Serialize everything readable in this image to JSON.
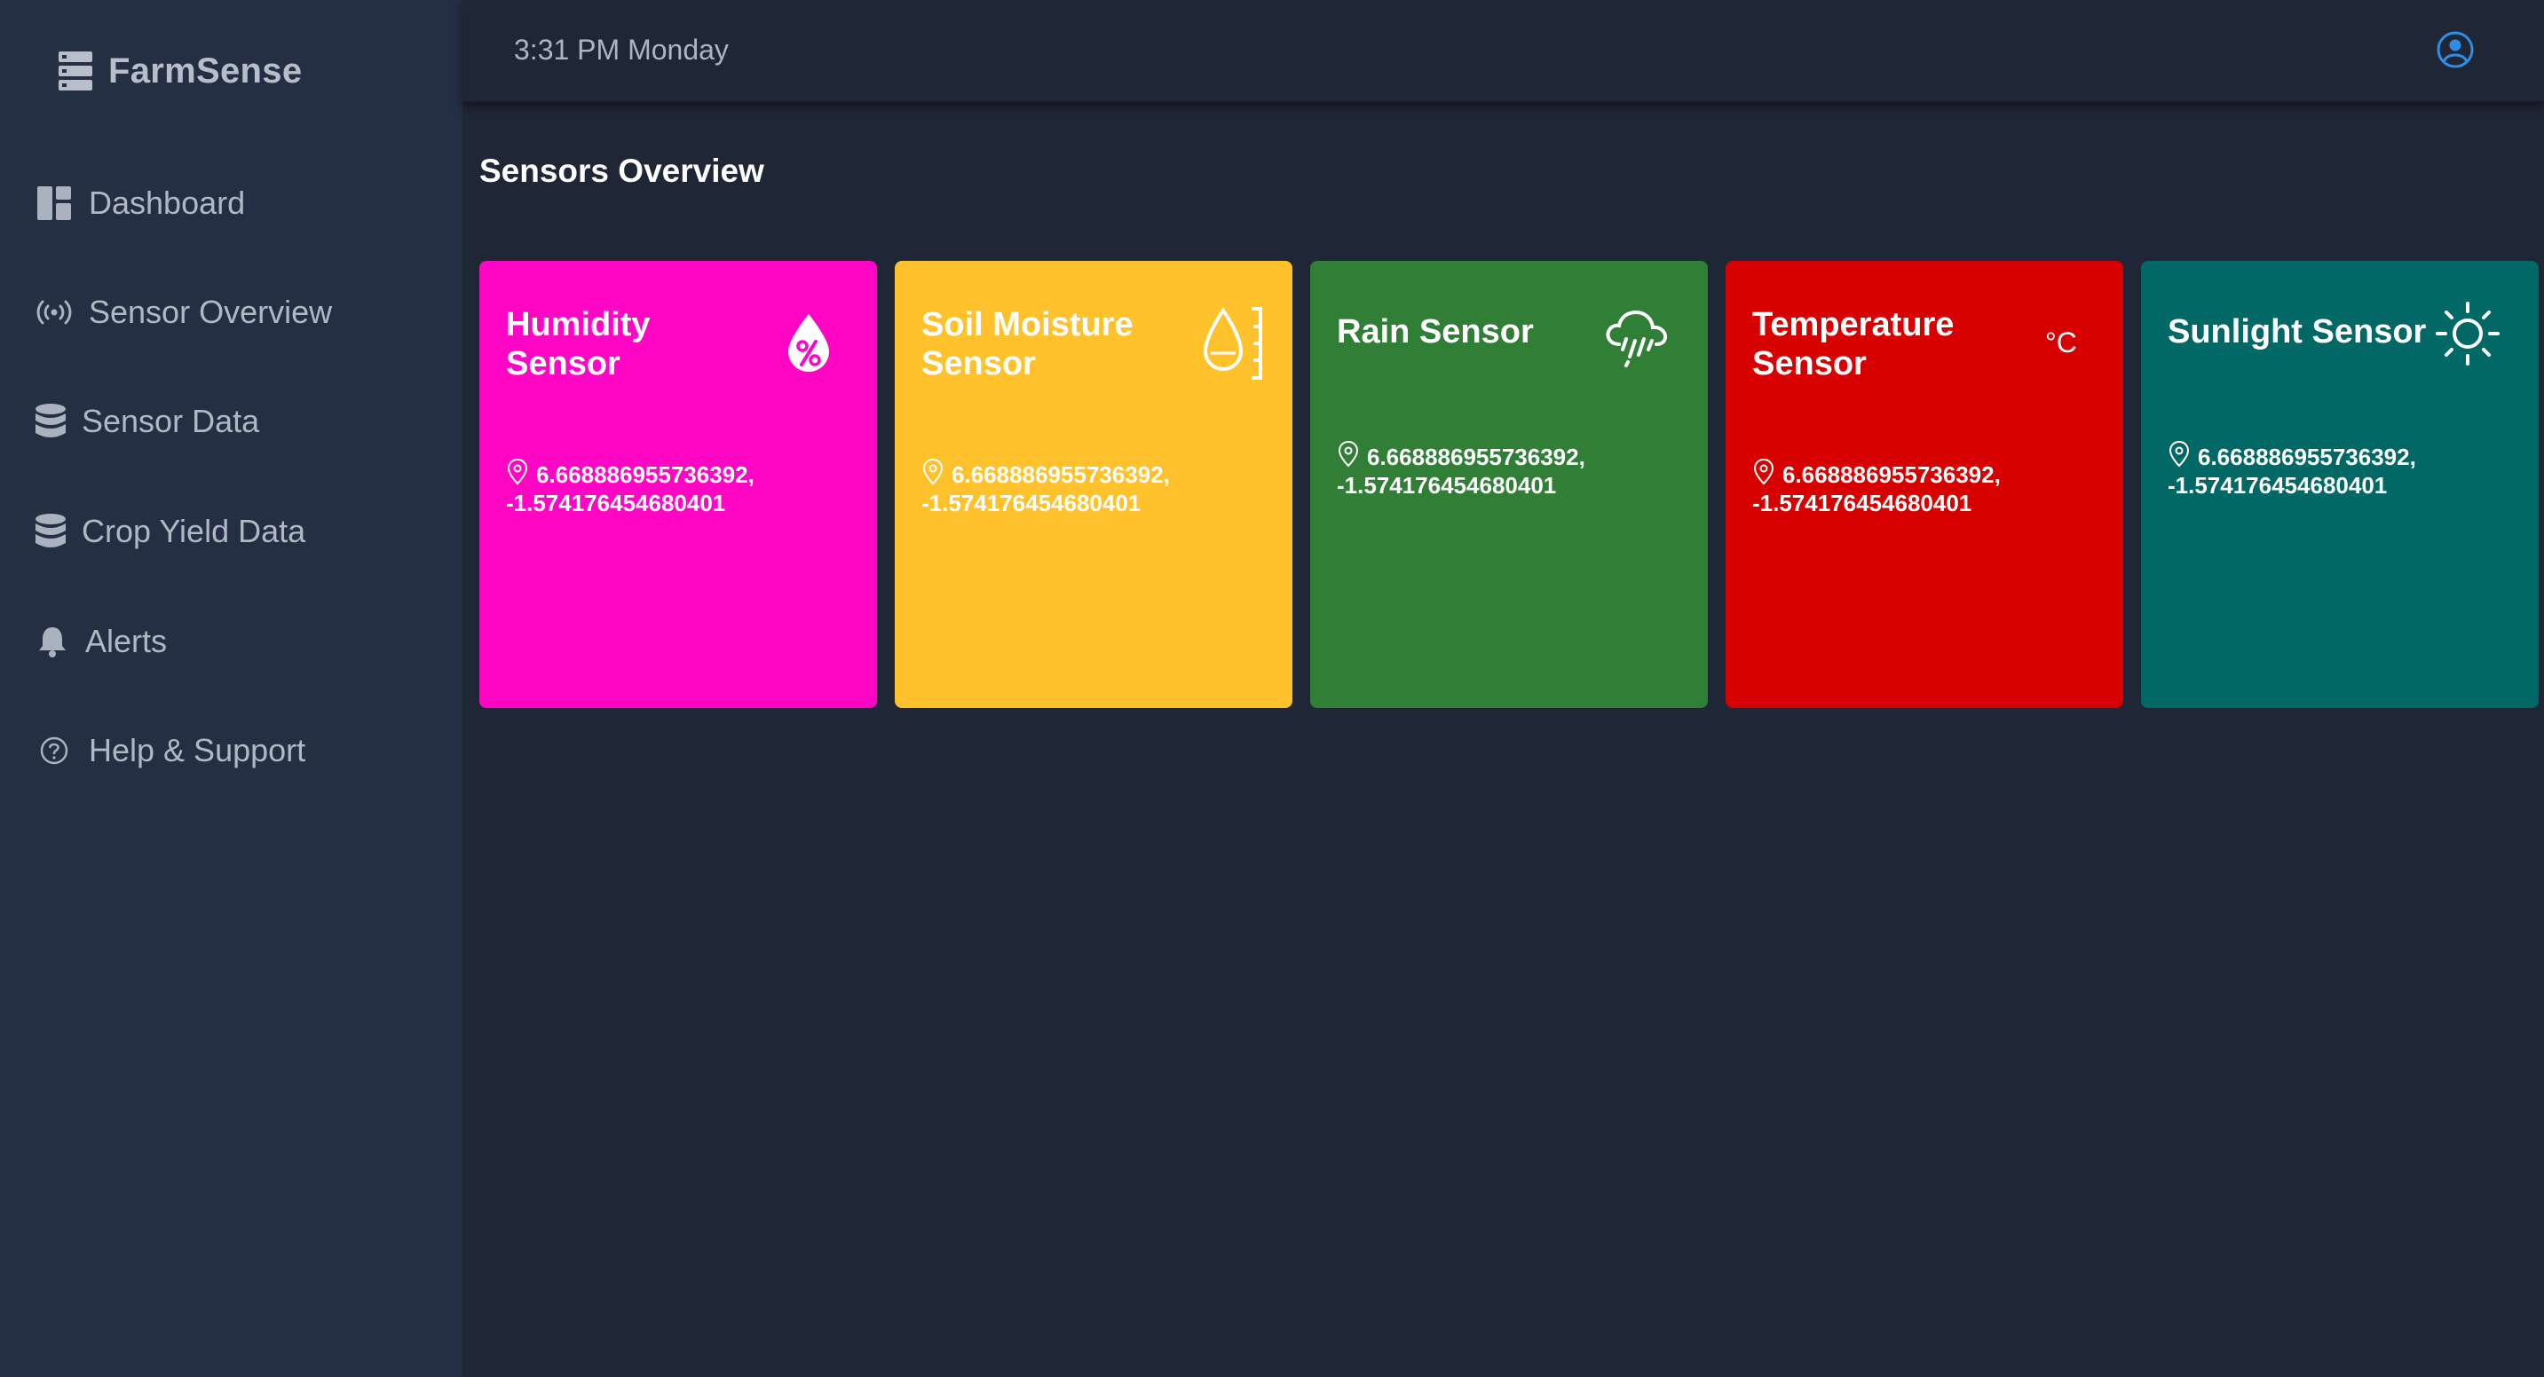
{
  "app": {
    "name": "FarmSense"
  },
  "sidebar": {
    "items": [
      {
        "label": "Dashboard",
        "icon": "dashboard-icon"
      },
      {
        "label": "Sensor Overview",
        "icon": "broadcast-icon"
      },
      {
        "label": "Sensor Data",
        "icon": "database-icon"
      },
      {
        "label": "Crop Yield Data",
        "icon": "database-icon"
      },
      {
        "label": "Alerts",
        "icon": "bell-icon"
      },
      {
        "label": "Help & Support",
        "icon": "help-icon"
      }
    ]
  },
  "header": {
    "time": "3:31 PM Monday",
    "user_icon": "user-circle-icon"
  },
  "main": {
    "title": "Sensors Overview",
    "cards": [
      {
        "title_line1": "Humidity",
        "title_line2": "Sensor",
        "icon": "humidity-drop-percent-icon",
        "coord_lat": "6.668886955736392,",
        "coord_lng": "-1.574176454680401",
        "color": "#ff06c5"
      },
      {
        "title_line1": "Soil Moisture",
        "title_line2": "Sensor",
        "icon": "soil-moisture-icon",
        "coord_lat": "6.668886955736392,",
        "coord_lng": "-1.574176454680401",
        "color": "#ffc22c"
      },
      {
        "title_line1": "Rain Sensor",
        "title_line2": "",
        "icon": "rain-cloud-icon",
        "coord_lat": "6.668886955736392,",
        "coord_lng": "-1.574176454680401",
        "color": "#317f37"
      },
      {
        "title_line1": "Temperature",
        "title_line2": "Sensor",
        "icon": "celsius-icon",
        "icon_text": "°C",
        "coord_lat": "6.668886955736392,",
        "coord_lng": "-1.574176454680401",
        "color": "#d60000"
      },
      {
        "title_line1": "Sunlight Sensor",
        "title_line2": "",
        "icon": "sun-icon",
        "coord_lat": "6.668886955736392,",
        "coord_lng": "-1.574176454680401",
        "color": "#026866"
      }
    ]
  }
}
